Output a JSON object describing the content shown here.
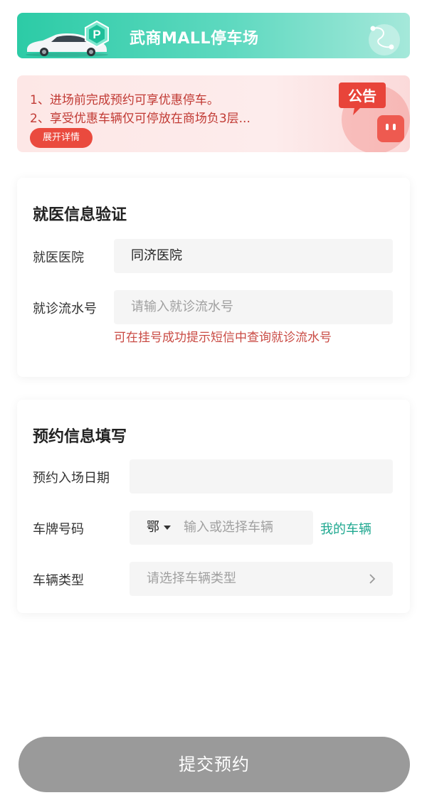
{
  "header": {
    "title": "武商MALL停车场",
    "badge_letter": "P"
  },
  "notice": {
    "line1": "1、进场前完成预约可享优惠停车。",
    "line2": "2、享受优惠车辆仅可停放在商场负3层...",
    "expand_label": "展开详情",
    "tag": "公告"
  },
  "medical": {
    "title": "就医信息验证",
    "hospital_label": "就医医院",
    "hospital_value": "同济医院",
    "serial_label": "就诊流水号",
    "serial_placeholder": "请输入就诊流水号",
    "hint": "可在挂号成功提示短信中查询就诊流水号"
  },
  "reservation": {
    "title": "预约信息填写",
    "date_label": "预约入场日期",
    "date_value": "",
    "plate_label": "车牌号码",
    "plate_prefix": "鄂",
    "plate_placeholder": "输入或选择车辆",
    "my_vehicles": "我的车辆",
    "type_label": "车辆类型",
    "type_placeholder": "请选择车辆类型"
  },
  "submit": {
    "label": "提交预约"
  },
  "colors": {
    "brand_green": "#2ccba6",
    "notice_red": "#c13a34",
    "hint_red": "#c94a43",
    "link_green": "#1fa890",
    "submit_disabled": "#9a9a9a"
  },
  "icons": [
    "car-icon",
    "parking-badge-icon",
    "route-icon",
    "notice-speaker-icon",
    "chevron-down-icon",
    "chevron-right-icon"
  ]
}
